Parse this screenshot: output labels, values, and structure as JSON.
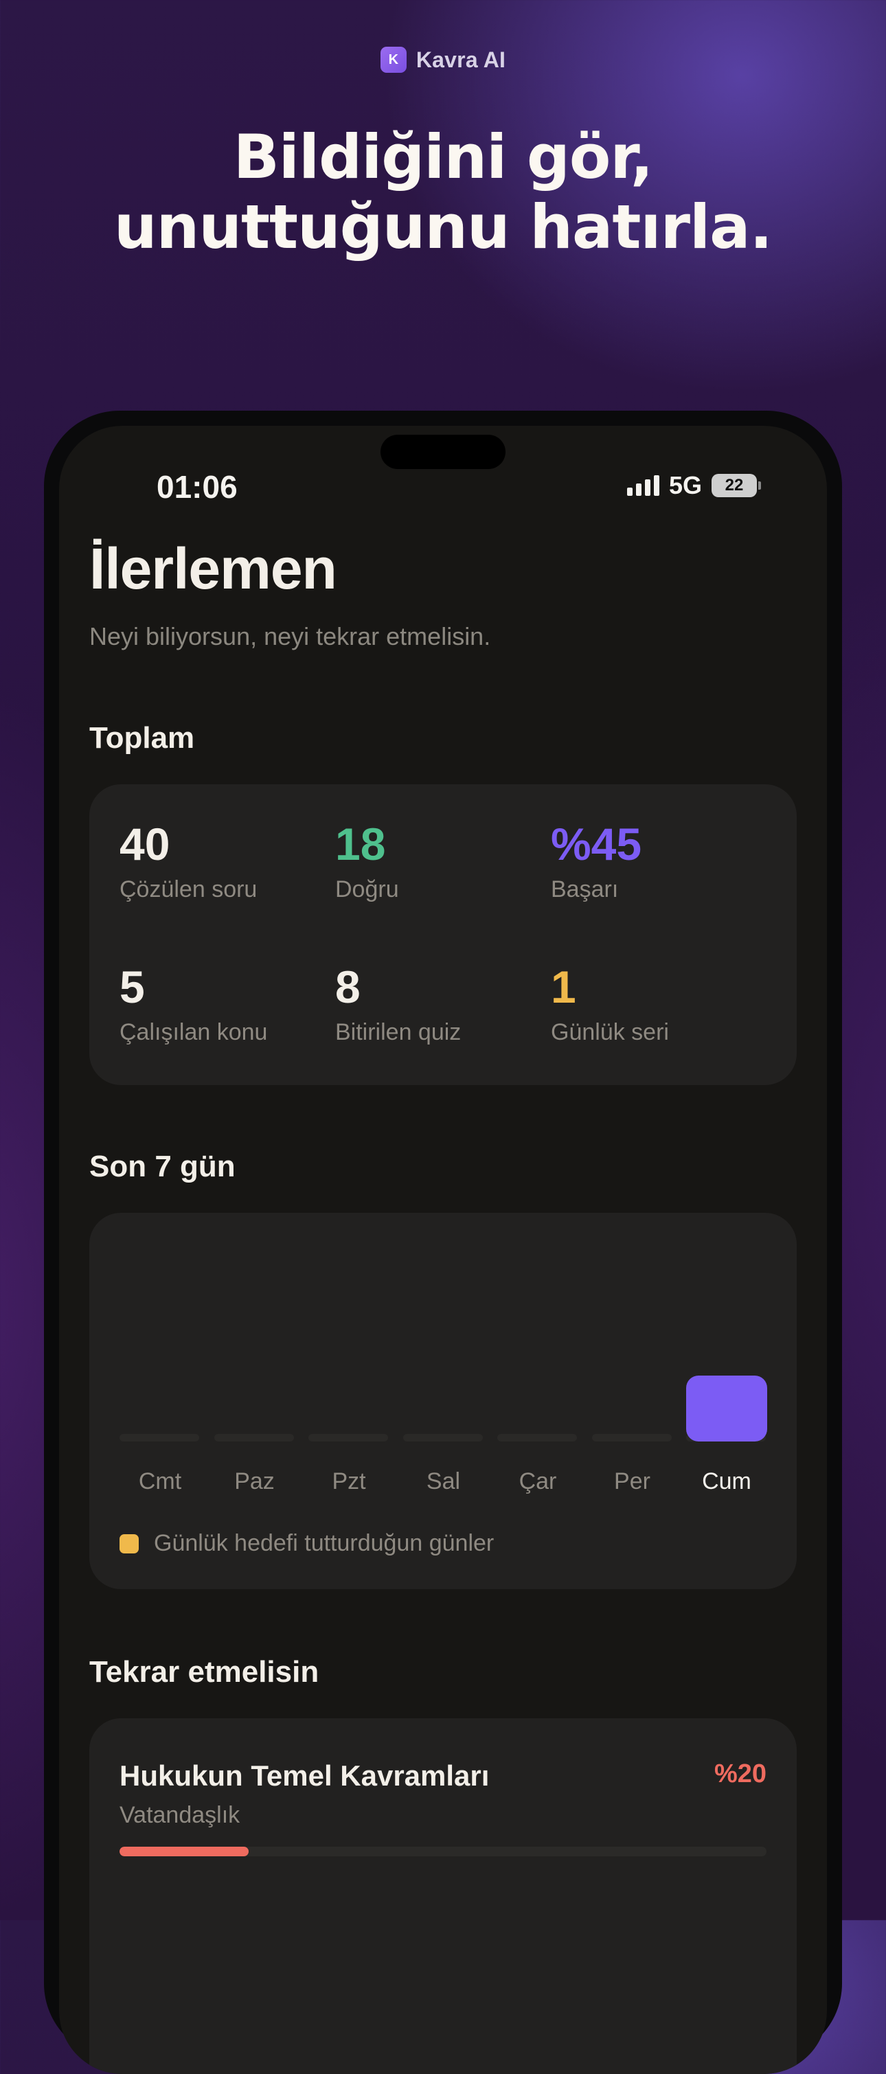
{
  "brand": {
    "badge": "K",
    "name": "Kavra AI"
  },
  "headline": {
    "line1": "Bildiğini gör,",
    "line2": "unuttuğunu hatırla."
  },
  "status": {
    "time": "01:06",
    "network": "5G",
    "battery": "22"
  },
  "page": {
    "title": "İlerlemen",
    "subtitle": "Neyi biliyorsun, neyi tekrar etmelisin."
  },
  "totals": {
    "title": "Toplam",
    "stats": [
      {
        "value": "40",
        "label": "Çözülen soru",
        "color": "#f3efe8"
      },
      {
        "value": "18",
        "label": "Doğru",
        "color": "#4fc08d"
      },
      {
        "value": "%45",
        "label": "Başarı",
        "color": "#7c5cf4"
      },
      {
        "value": "5",
        "label": "Çalışılan konu",
        "color": "#f3efe8"
      },
      {
        "value": "8",
        "label": "Bitirilen quiz",
        "color": "#f3efe8"
      },
      {
        "value": "1",
        "label": "Günlük seri",
        "color": "#f0b94b"
      }
    ]
  },
  "last7": {
    "title": "Son 7 gün",
    "days": [
      "Cmt",
      "Paz",
      "Pzt",
      "Sal",
      "Çar",
      "Per",
      "Cum"
    ],
    "active_day": "Cum",
    "legend": "Günlük hedefi tutturduğun günler",
    "legend_color": "#f0b94b",
    "bar_color": "#7c5cf4"
  },
  "chart_data": {
    "type": "bar",
    "categories": [
      "Cmt",
      "Paz",
      "Pzt",
      "Sal",
      "Çar",
      "Per",
      "Cum"
    ],
    "values": [
      0,
      0,
      0,
      0,
      0,
      0,
      1
    ],
    "legend": "Günlük hedefi tutturduğun günler"
  },
  "review": {
    "title": "Tekrar etmelisin",
    "items": [
      {
        "name": "Hukukun Temel Kavramları",
        "subject": "Vatandaşlık",
        "percent_label": "%20",
        "percent": 20
      }
    ]
  }
}
